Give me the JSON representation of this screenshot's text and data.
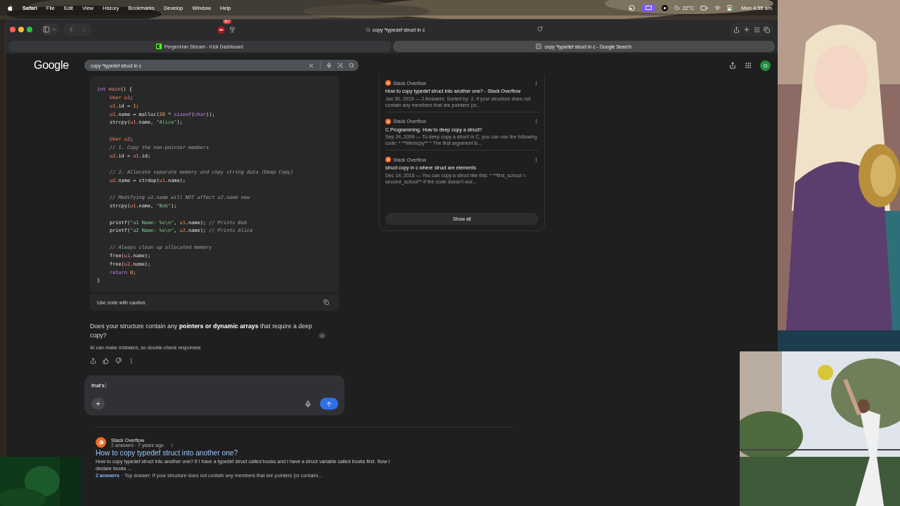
{
  "menu_bar": {
    "app": "Safari",
    "menus": [
      "File",
      "Edit",
      "View",
      "History",
      "Bookmarks",
      "Develop",
      "Window",
      "Help"
    ],
    "weather": "22°C",
    "clock": "Mon 4:55 am"
  },
  "browser": {
    "toolbar": {
      "extension_badge": "87",
      "address": "copy *typedef struct in c"
    },
    "tabs": [
      {
        "title": "PergenHan Stream - Kick Dashboard",
        "selected": false
      },
      {
        "title": "copy *typedef struct in c - Google Search",
        "selected": true
      }
    ]
  },
  "google": {
    "logo": "Google",
    "search": {
      "value": "copy *typedef struct in c"
    },
    "avatar": "G"
  },
  "ai_overview": {
    "code": {
      "lines": [
        {
          "kind": "code",
          "tokens": [
            {
              "text": "int",
              "kind": "keyword"
            },
            {
              "text": " main",
              "kind": "function"
            },
            {
              "text": "() {"
            }
          ],
          "children": [
            {
              "kind": "code",
              "tokens": [
                {
                  "text": "User u1",
                  "kind": "variable"
                },
                {
                  "text": ";"
                }
              ]
            },
            {
              "kind": "code",
              "tokens": [
                {
                  "text": "u1",
                  "kind": "variable"
                },
                {
                  "text": ".id = "
                },
                {
                  "text": "1",
                  "kind": "number"
                },
                {
                  "text": ";"
                }
              ]
            },
            {
              "kind": "code",
              "tokens": [
                {
                  "text": "u1",
                  "kind": "variable"
                },
                {
                  "text": ".name = malloc("
                },
                {
                  "text": "20",
                  "kind": "number"
                },
                {
                  "text": " * "
                },
                {
                  "text": "sizeof",
                  "kind": "keyword"
                },
                {
                  "text": "("
                },
                {
                  "text": "char",
                  "kind": "keyword"
                },
                {
                  "text": "));"
                }
              ]
            },
            {
              "kind": "code",
              "tokens": [
                {
                  "text": "strcpy("
                },
                {
                  "text": "u1",
                  "kind": "variable"
                },
                {
                  "text": ".name, "
                },
                {
                  "text": "\"Alice\"",
                  "kind": "string"
                },
                {
                  "text": ");"
                }
              ]
            },
            {
              "kind": "blank"
            },
            {
              "kind": "code",
              "tokens": [
                {
                  "text": "User u2",
                  "kind": "variable"
                },
                {
                  "text": ";"
                }
              ]
            },
            {
              "kind": "code",
              "tokens": [
                {
                  "text": "// 1. Copy the non-pointer members",
                  "kind": "comment"
                }
              ]
            },
            {
              "kind": "code",
              "tokens": [
                {
                  "text": "u2",
                  "kind": "variable"
                },
                {
                  "text": ".id = "
                },
                {
                  "text": "u1",
                  "kind": "variable"
                },
                {
                  "text": ".id;"
                }
              ]
            },
            {
              "kind": "blank"
            },
            {
              "kind": "code",
              "tokens": [
                {
                  "text": "// 2. Allocate separate memory and copy string data (Deep Copy)",
                  "kind": "comment"
                }
              ]
            },
            {
              "kind": "code",
              "tokens": [
                {
                  "text": "u2",
                  "kind": "variable"
                },
                {
                  "text": ".name = strdup("
                },
                {
                  "text": "u1",
                  "kind": "variable"
                },
                {
                  "text": ".name);"
                }
              ]
            },
            {
              "kind": "blank"
            },
            {
              "kind": "code",
              "tokens": [
                {
                  "text": "// Modifying u1.name will NOT affect u2.name now",
                  "kind": "comment"
                }
              ]
            },
            {
              "kind": "code",
              "tokens": [
                {
                  "text": "strcpy("
                },
                {
                  "text": "u1",
                  "kind": "variable"
                },
                {
                  "text": ".name, "
                },
                {
                  "text": "\"Bob\"",
                  "kind": "string"
                },
                {
                  "text": ");"
                }
              ]
            },
            {
              "kind": "blank"
            },
            {
              "kind": "code",
              "tokens": [
                {
                  "text": "printf("
                },
                {
                  "text": "\"u1 Name: %s\\n\"",
                  "kind": "string"
                },
                {
                  "text": ", "
                },
                {
                  "text": "u1",
                  "kind": "variable"
                },
                {
                  "text": ".name); "
                },
                {
                  "text": "// Prints Bob",
                  "kind": "comment"
                }
              ]
            },
            {
              "kind": "code",
              "tokens": [
                {
                  "text": "printf("
                },
                {
                  "text": "\"u2 Name: %s\\n\"",
                  "kind": "string"
                },
                {
                  "text": ", "
                },
                {
                  "text": "u2",
                  "kind": "variable"
                },
                {
                  "text": ".name); "
                },
                {
                  "text": "// Prints Alice",
                  "kind": "comment"
                }
              ]
            },
            {
              "kind": "blank"
            },
            {
              "kind": "code",
              "tokens": [
                {
                  "text": "// Always clean up allocated memory",
                  "kind": "comment"
                }
              ]
            },
            {
              "kind": "code",
              "tokens": [
                {
                  "text": "free("
                },
                {
                  "text": "u1",
                  "kind": "variable"
                },
                {
                  "text": ".name);"
                }
              ]
            },
            {
              "kind": "code",
              "tokens": [
                {
                  "text": "free("
                },
                {
                  "text": "u2",
                  "kind": "variable"
                },
                {
                  "text": ".name);"
                }
              ]
            },
            {
              "kind": "code",
              "tokens": [
                {
                  "text": "return",
                  "kind": "keyword"
                },
                {
                  "text": " 0",
                  "kind": "number"
                },
                {
                  "text": ";"
                }
              ]
            }
          ]
        },
        {
          "kind": "code",
          "tokens": [
            {
              "text": "}"
            }
          ]
        }
      ]
    },
    "caution": "Use code with caution.",
    "question": "Does your structure contain any **pointers or dynamic arrays** that require a deep copy?",
    "disclaimer": "AI can make mistakes, so double-check responses",
    "prompt": {
      "value": "that's"
    }
  },
  "sources": {
    "items": [
      {
        "source": "Stack Overflow",
        "title": "How to copy typedef struct into another one? - Stack Overflow",
        "snippet": "Jan 30, 2019 — 2 Answers. Sorted by: 2. If your structure does not contain any members that are pointers (or..."
      },
      {
        "source": "Stack Overflow",
        "title": "C Programming. How to deep copy a struct?",
        "snippet": "Sep 24, 2009 — To deep copy a struct in C, you can use the following code: * **Memcpy** * The first argument is..."
      },
      {
        "source": "Stack Overflow",
        "title": "struct copy in c where struct are elements",
        "snippet": "Dec 14, 2016 — You can copy a struct like this: * **first_school = second_school** If the code doesn't wor..."
      }
    ],
    "show_all": "Show all"
  },
  "results": [
    {
      "source": "Stack Overflow",
      "meta": "2 answers · 7 years ago",
      "title": "How to copy typedef struct into another one?",
      "snippet": "How to copy typedef struct into another one? If I have a typedef struct called books and I have a struct variable called books first. Now I declare books ...",
      "answers": "2 answers",
      "top_answer": "· Top answer: If your structure does not contain any members that are pointers (or containi..."
    }
  ]
}
